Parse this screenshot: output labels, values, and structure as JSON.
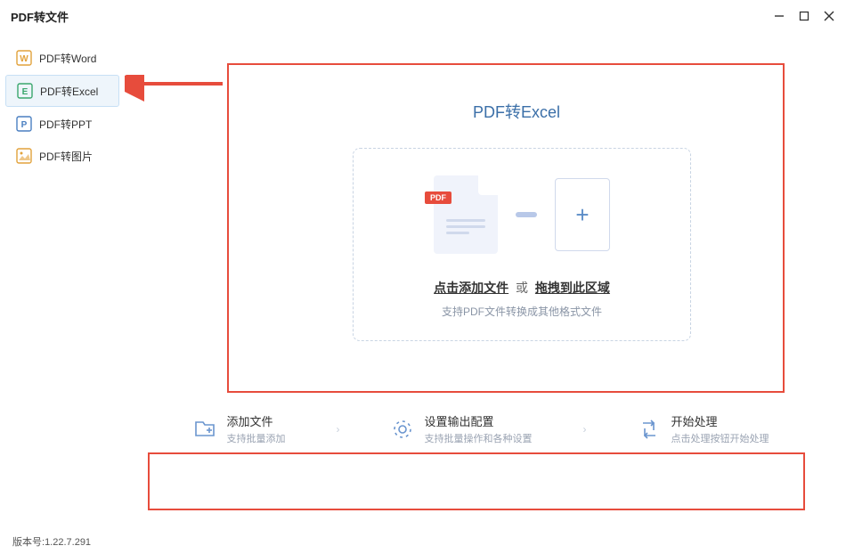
{
  "titlebar": {
    "title": "PDF转文件"
  },
  "sidebar": {
    "items": [
      {
        "label": "PDF转Word",
        "icon": "W",
        "color": "#e2a23b",
        "active": false
      },
      {
        "label": "PDF转Excel",
        "icon": "E",
        "color": "#3aa76d",
        "active": true
      },
      {
        "label": "PDF转PPT",
        "icon": "P",
        "color": "#4a7fc1",
        "active": false
      },
      {
        "label": "PDF转图片",
        "icon": "▦",
        "color": "#e2a23b",
        "active": false
      }
    ]
  },
  "main": {
    "title": "PDF转Excel",
    "pdf_badge": "PDF",
    "drop_link1": "点击添加文件",
    "drop_sep": "或",
    "drop_link2": "拖拽到此区域",
    "drop_hint": "支持PDF文件转换成其他格式文件"
  },
  "steps": [
    {
      "title": "添加文件",
      "sub": "支持批量添加"
    },
    {
      "title": "设置输出配置",
      "sub": "支持批量操作和各种设置"
    },
    {
      "title": "开始处理",
      "sub": "点击处理按钮开始处理"
    }
  ],
  "footer": {
    "version_label": "版本号:",
    "version": "1.22.7.291"
  }
}
